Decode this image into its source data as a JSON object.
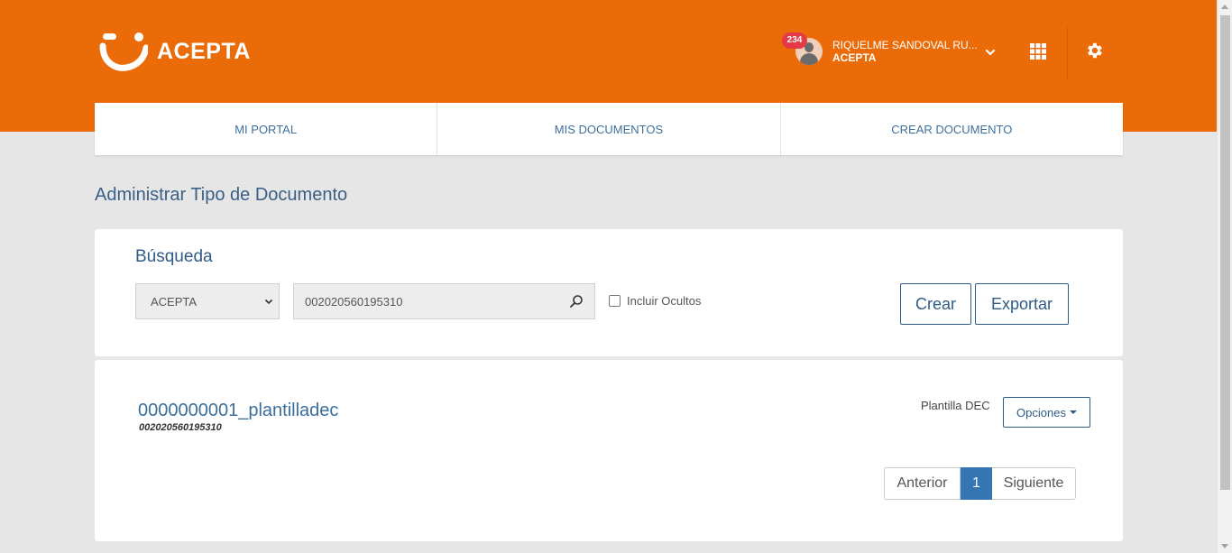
{
  "brand": {
    "name": "ACEPTA"
  },
  "user": {
    "notifications": "234",
    "name": "RIQUELME SANDOVAL RU...",
    "company": "ACEPTA"
  },
  "nav": {
    "items": [
      {
        "label": "MI PORTAL"
      },
      {
        "label": "MIS DOCUMENTOS"
      },
      {
        "label": "CREAR DOCUMENTO"
      }
    ]
  },
  "page": {
    "title": "Administrar Tipo de Documento"
  },
  "search": {
    "title": "Búsqueda",
    "company_select": "ACEPTA",
    "query": "002020560195310",
    "include_hidden_label": "Incluir Ocultos",
    "create_label": "Crear",
    "export_label": "Exportar"
  },
  "results": [
    {
      "name": "0000000001_plantilladec",
      "id": "002020560195310",
      "type": "Plantilla DEC",
      "options_label": "Opciones"
    }
  ],
  "pagination": {
    "prev": "Anterior",
    "current": "1",
    "next": "Siguiente"
  },
  "colors": {
    "header": "#ec6b09",
    "primary": "#2f5b86",
    "page_active": "#3575b1",
    "badge": "#e53946"
  },
  "icons": [
    "acepta-logo-icon",
    "user-avatar-icon",
    "chevron-down-icon",
    "apps-grid-icon",
    "gear-icon",
    "search-icon"
  ]
}
